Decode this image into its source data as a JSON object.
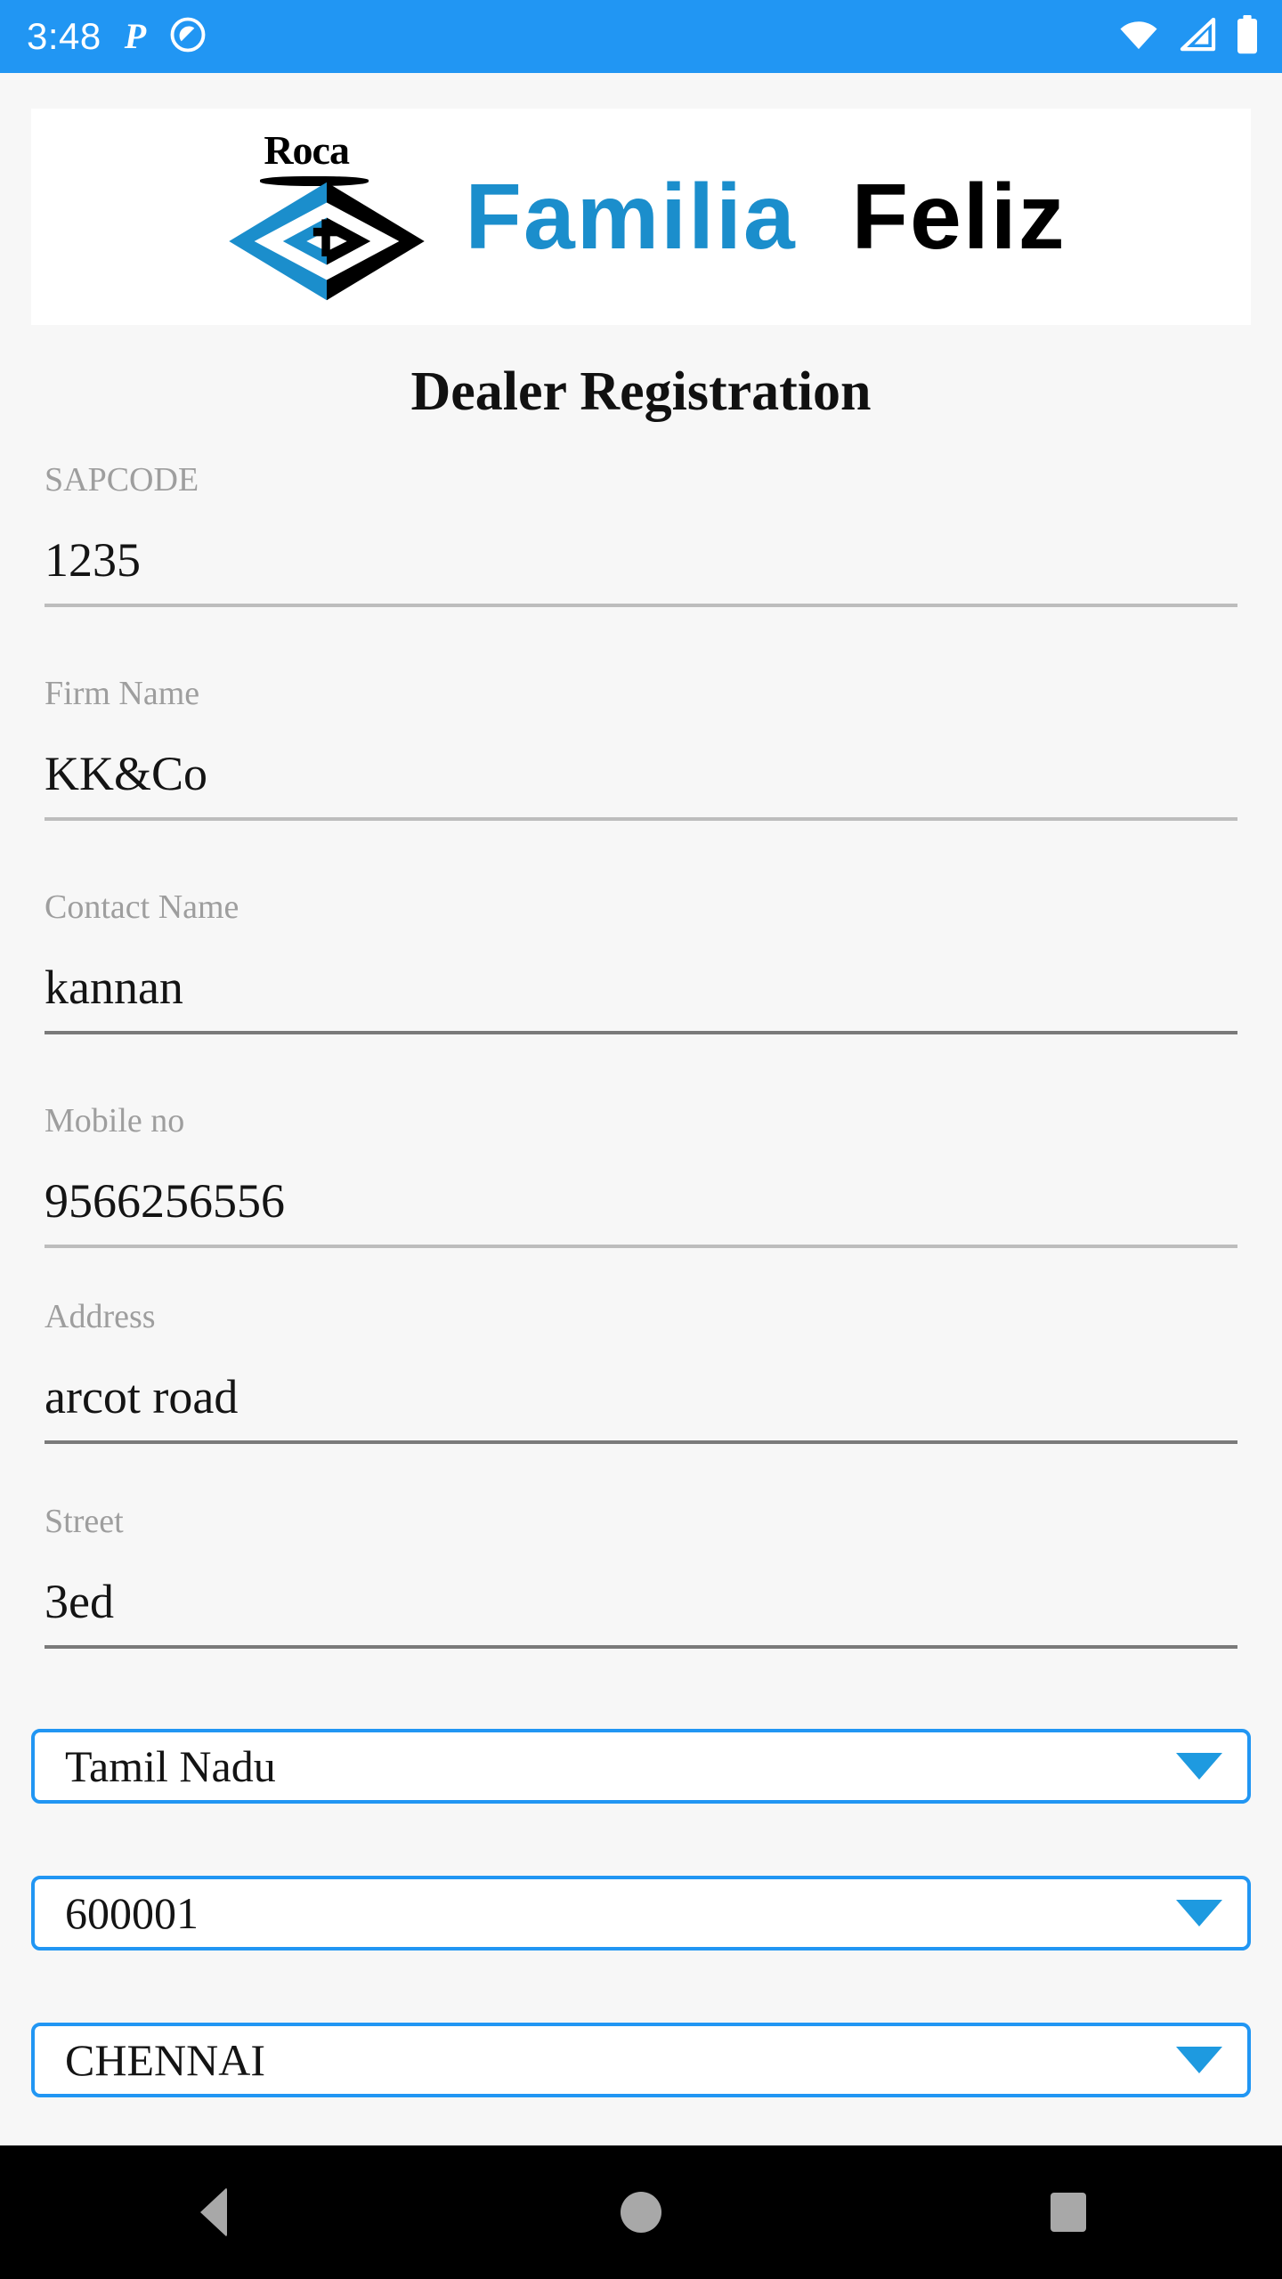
{
  "status_bar": {
    "time": "3:48",
    "left_icons": [
      "pandora-p-icon",
      "do-not-disturb-icon"
    ],
    "right_icons": [
      "wifi-icon",
      "cellular-signal-icon",
      "battery-full-icon"
    ],
    "background_color": "#2196f3"
  },
  "logo": {
    "brand_top": "Roca",
    "word_primary": "Familia",
    "word_secondary": "Feliz",
    "primary_color": "#1b8ecc",
    "secondary_color": "#000000"
  },
  "page": {
    "title": "Dealer Registration"
  },
  "form": {
    "fields": [
      {
        "label": "SAPCODE",
        "value": "1235",
        "underline": "light"
      },
      {
        "label": "Firm Name",
        "value": "KK&Co",
        "underline": "light"
      },
      {
        "label": "Contact Name",
        "value": "kannan",
        "underline": "dark"
      },
      {
        "label": "Mobile no",
        "value": "9566256556",
        "underline": "light"
      },
      {
        "label": "Address",
        "value": "arcot road",
        "underline": "dark"
      },
      {
        "label": "Street",
        "value": "3ed",
        "underline": "dark"
      }
    ],
    "dropdowns": [
      {
        "name": "state",
        "value": "Tamil Nadu"
      },
      {
        "name": "pincode",
        "value": "600001"
      },
      {
        "name": "city",
        "value": "CHENNAI"
      }
    ],
    "accent_color": "#2196f3",
    "caret_color": "#1e9ae0"
  },
  "nav_bar": {
    "buttons": [
      "back",
      "home",
      "recents"
    ],
    "icon_color": "#a8a8a8",
    "background_color": "#000000"
  }
}
